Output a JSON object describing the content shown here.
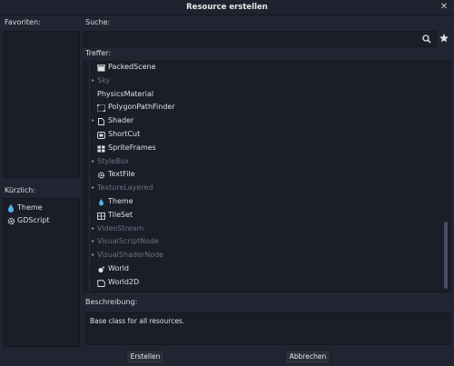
{
  "window": {
    "title": "Resource erstellen",
    "close_glyph": "✕"
  },
  "favorites": {
    "label": "Favoriten:"
  },
  "recent": {
    "label": "Kürzlich:",
    "items": [
      {
        "label": "Theme",
        "icon": "droplet-icon"
      },
      {
        "label": "GDScript",
        "icon": "gear-icon"
      }
    ]
  },
  "search": {
    "label": "Suche:",
    "value": "",
    "placeholder": ""
  },
  "results": {
    "label": "Treffer:",
    "items": [
      {
        "label": "PackedScene",
        "icon": "clapperboard-icon",
        "arrow": "",
        "disabled": false
      },
      {
        "label": "Sky",
        "icon": "",
        "arrow": "▸",
        "disabled": true
      },
      {
        "label": "PhysicsMaterial",
        "icon": "",
        "arrow": "",
        "disabled": false
      },
      {
        "label": "PolygonPathFinder",
        "icon": "polygon-dots-icon",
        "arrow": "",
        "disabled": false
      },
      {
        "label": "Shader",
        "icon": "document-icon",
        "arrow": "▸",
        "disabled": false
      },
      {
        "label": "ShortCut",
        "icon": "shortcut-icon",
        "arrow": "",
        "disabled": false
      },
      {
        "label": "SpriteFrames",
        "icon": "sprite-grid-icon",
        "arrow": "",
        "disabled": false
      },
      {
        "label": "StyleBox",
        "icon": "",
        "arrow": "▸",
        "disabled": true
      },
      {
        "label": "TextFile",
        "icon": "gear-icon",
        "arrow": "",
        "disabled": false
      },
      {
        "label": "TextureLayered",
        "icon": "",
        "arrow": "▸",
        "disabled": true
      },
      {
        "label": "Theme",
        "icon": "droplet-icon",
        "arrow": "",
        "disabled": false
      },
      {
        "label": "TileSet",
        "icon": "tileset-icon",
        "arrow": "",
        "disabled": false
      },
      {
        "label": "VideoStream",
        "icon": "",
        "arrow": "▸",
        "disabled": true
      },
      {
        "label": "VisualScriptNode",
        "icon": "",
        "arrow": "▸",
        "disabled": true
      },
      {
        "label": "VisualShaderNode",
        "icon": "",
        "arrow": "▸",
        "disabled": true
      },
      {
        "label": "World",
        "icon": "sphere-icon",
        "arrow": "",
        "disabled": false
      },
      {
        "label": "World2D",
        "icon": "world2d-icon",
        "arrow": "",
        "disabled": false
      }
    ]
  },
  "description": {
    "label": "Beschreibung:",
    "text": "Base class for all resources."
  },
  "buttons": {
    "create": "Erstellen",
    "cancel": "Abbrechen"
  },
  "colors": {
    "background": "#202531",
    "panel": "#1a1e29",
    "accent": "#4fb3e8",
    "disabled_text": "#6b7180"
  }
}
